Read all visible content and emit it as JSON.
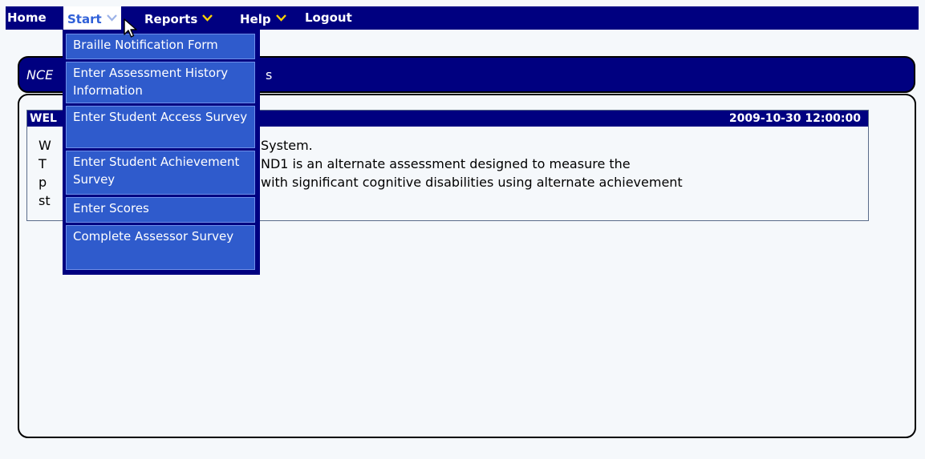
{
  "menubar": {
    "home": "Home",
    "start": "Start",
    "reports": "Reports",
    "help": "Help",
    "logout": "Logout"
  },
  "title_panel": {
    "visible_prefix": "NCE",
    "visible_suffix": "s"
  },
  "welcome": {
    "header_visible": "WEL",
    "timestamp": "2009-10-30 12:00:00",
    "line1_left": "W",
    "line1_right": "System.",
    "line2_left": "T",
    "line2_right": "ND1 is an alternate assessment designed to measure the",
    "line3_left": "p",
    "line3_right": "with significant cognitive disabilities using alternate achievement",
    "line4_left": "st"
  },
  "dropdown": {
    "items": [
      {
        "label": "Braille Notification Form"
      },
      {
        "label": "Enter Assessment History Information"
      },
      {
        "label": "Enter Student Access Survey"
      },
      {
        "label": "Enter Student Achievement Survey"
      },
      {
        "label": "Enter Scores"
      },
      {
        "label": "Complete Assessor Survey"
      }
    ]
  },
  "icons": {
    "chevron": "chevron-down-icon",
    "cursor": "mouse-pointer-icon"
  },
  "colors": {
    "navy": "#000080",
    "menu_item_blue": "#2f5bcc",
    "chevron_yellow": "#ffd400",
    "active_text": "#2f60d8"
  }
}
